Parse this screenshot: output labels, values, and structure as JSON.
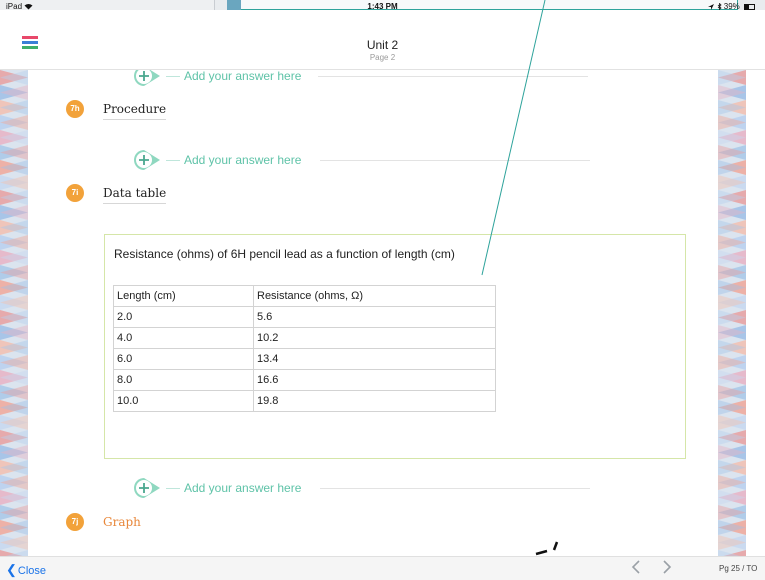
{
  "status_bar": {
    "carrier": "iPad",
    "time": "1:43 PM",
    "battery": "39%"
  },
  "header": {
    "title": "Unit 2",
    "subtitle": "Page 2"
  },
  "prompts": {
    "add_answer": "Add your answer here"
  },
  "sections": [
    {
      "badge": "7h",
      "title": "Procedure"
    },
    {
      "badge": "7i",
      "title": "Data table"
    },
    {
      "badge": "7j",
      "title": "Graph"
    }
  ],
  "data_table": {
    "caption": "Resistance (ohms) of 6H pencil lead as a function of length (cm)",
    "headers": [
      "Length (cm)",
      "Resistance (ohms, Ω)"
    ],
    "rows": [
      [
        "2.0",
        "5.6"
      ],
      [
        "4.0",
        "10.2"
      ],
      [
        "6.0",
        "13.4"
      ],
      [
        "8.0",
        "16.6"
      ],
      [
        "10.0",
        "19.8"
      ]
    ]
  },
  "footer": {
    "close_label": "Close",
    "page_indicator": "Pg 25 / TO"
  },
  "colors": {
    "accent_teal": "#5fc3a8",
    "badge_orange": "#f2a23a",
    "menu_red": "#e8486a",
    "menu_blue": "#3b7fd6",
    "menu_green": "#3fae6a"
  },
  "icons": {
    "menu": "list-menu-icon",
    "add": "plus-circle-icon",
    "prev": "chevron-left-icon",
    "next": "chevron-right-icon",
    "wifi": "wifi-icon",
    "battery": "battery-icon"
  }
}
